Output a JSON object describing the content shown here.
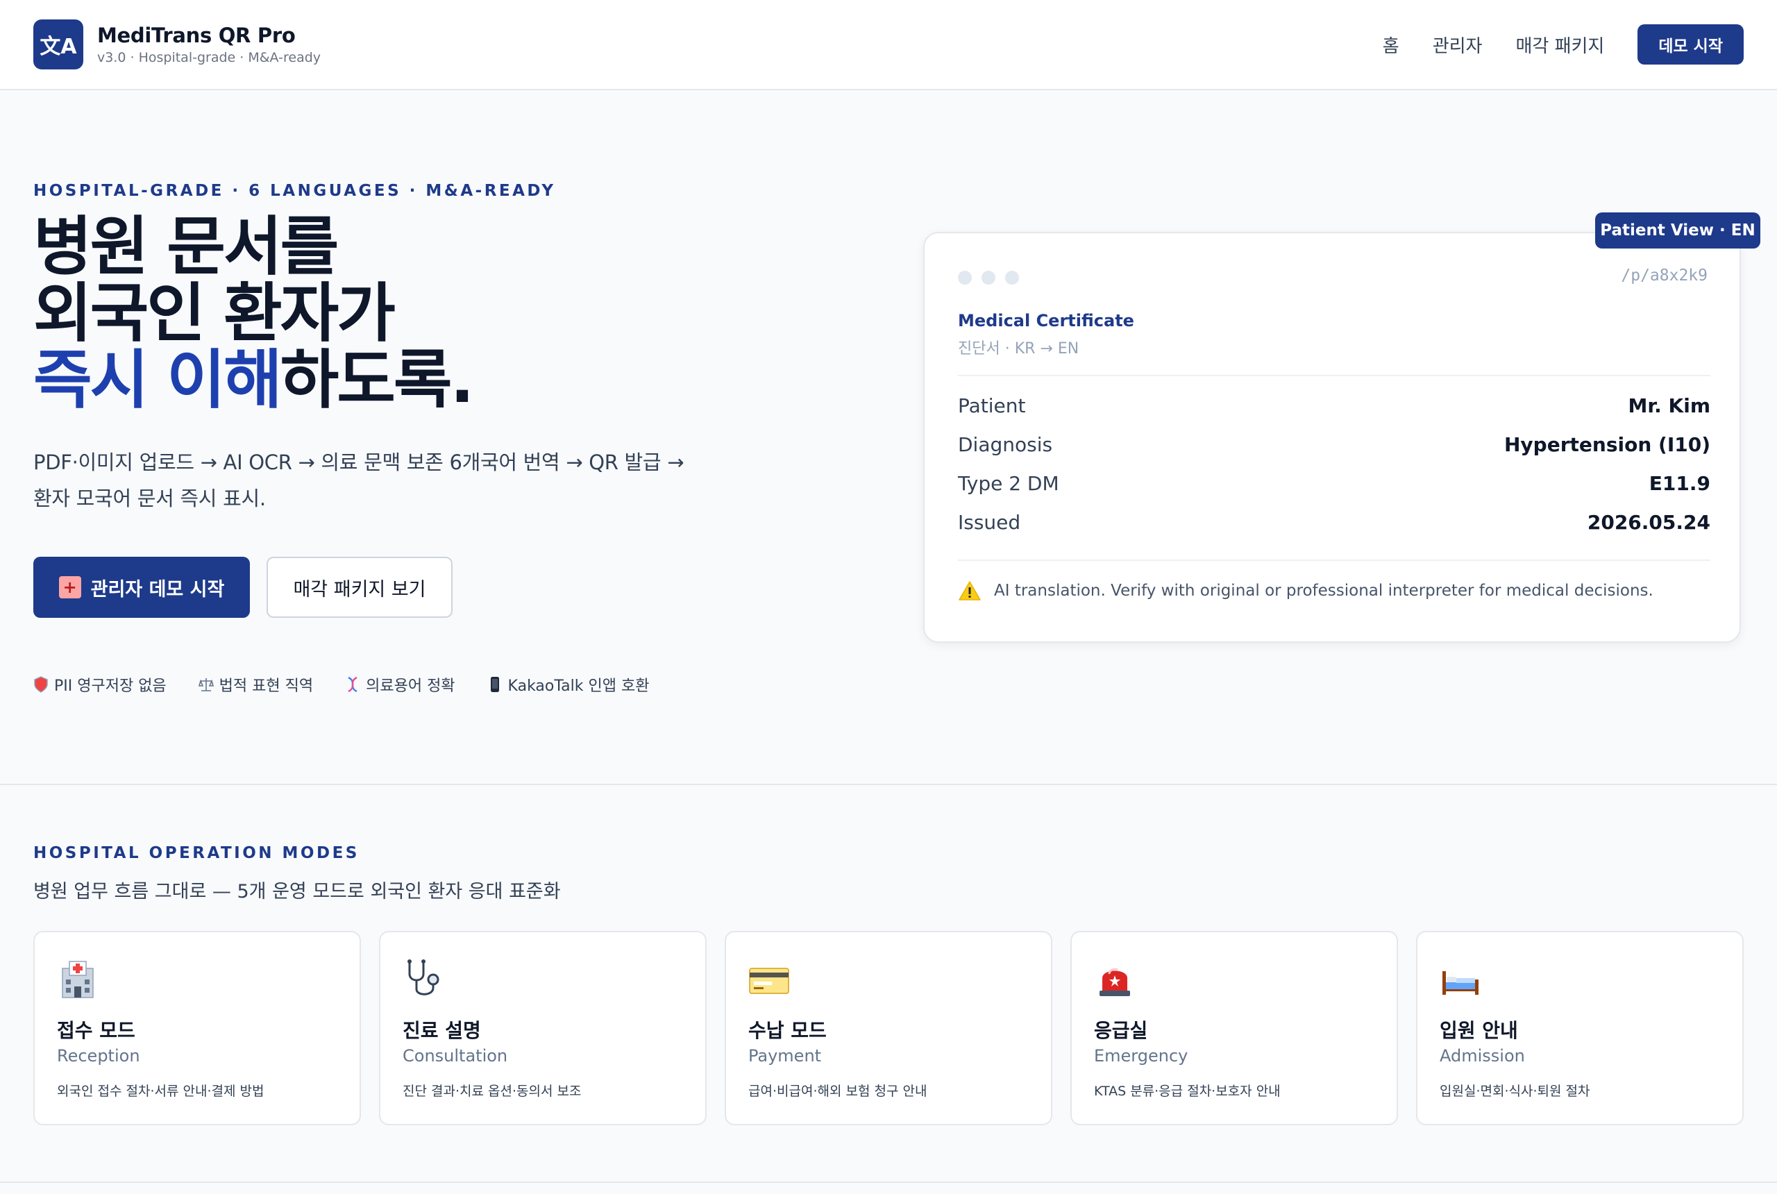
{
  "header": {
    "logo_glyph": "文A",
    "brand_name": "MediTrans QR Pro",
    "brand_sub": "v3.0 · Hospital-grade · M&A-ready",
    "nav": [
      "홈",
      "관리자",
      "매각 패키지"
    ],
    "cta_label": "데모 시작"
  },
  "hero": {
    "eyebrow": "HOSPITAL-GRADE · 6 LANGUAGES · M&A-READY",
    "title_line1": "병원 문서를",
    "title_line2": "외국인 환자가",
    "title_line3_accent": "즉시 이해",
    "title_line3_rest": "하도록.",
    "description": "PDF·이미지 업로드 → AI OCR → 의료 문맥 보존 6개국어 번역 → QR 발급 → 환자 모국어 문서 즉시 표시.",
    "primary_button": "관리자 데모 시작",
    "secondary_button": "매각 패키지 보기",
    "badges": [
      {
        "icon": "shield-icon",
        "label": "PII 영구저장 없음"
      },
      {
        "icon": "scales-icon",
        "label": "법적 표현 직역"
      },
      {
        "icon": "dna-icon",
        "label": "의료용어 정확"
      },
      {
        "icon": "phone-icon",
        "label": "KakaoTalk 인앱 호환"
      }
    ]
  },
  "preview": {
    "tag": "Patient View · EN",
    "url": "/p/a8x2k9",
    "doc_title": "Medical Certificate",
    "doc_sub": "진단서 · KR → EN",
    "rows": [
      {
        "key": "Patient",
        "value": "Mr. Kim"
      },
      {
        "key": "Diagnosis",
        "value": "Hypertension (I10)"
      },
      {
        "key": "Type 2 DM",
        "value": "E11.9"
      },
      {
        "key": "Issued",
        "value": "2026.05.24"
      }
    ],
    "warning": "AI translation. Verify with original or professional interpreter for medical decisions."
  },
  "modes": {
    "eyebrow": "HOSPITAL OPERATION MODES",
    "description": "병원 업무 흐름 그대로 — 5개 운영 모드로 외국인 환자 응대 표준화",
    "items": [
      {
        "icon": "hospital-icon",
        "title_ko": "접수 모드",
        "title_en": "Reception",
        "desc": "외국인 접수 절차·서류 안내·결제 방법"
      },
      {
        "icon": "stethoscope-icon",
        "title_ko": "진료 설명",
        "title_en": "Consultation",
        "desc": "진단 결과·치료 옵션·동의서 보조"
      },
      {
        "icon": "credit-card-icon",
        "title_ko": "수납 모드",
        "title_en": "Payment",
        "desc": "급여·비급여·해외 보험 청구 안내"
      },
      {
        "icon": "siren-icon",
        "title_ko": "응급실",
        "title_en": "Emergency",
        "desc": "KTAS 분류·응급 절차·보호자 안내"
      },
      {
        "icon": "bed-icon",
        "title_ko": "입원 안내",
        "title_en": "Admission",
        "desc": "입원실·면회·식사·퇴원 절차"
      }
    ]
  },
  "colors": {
    "brand": "#1e3a8a",
    "accent": "#1e40af",
    "warning": "#facc15"
  }
}
